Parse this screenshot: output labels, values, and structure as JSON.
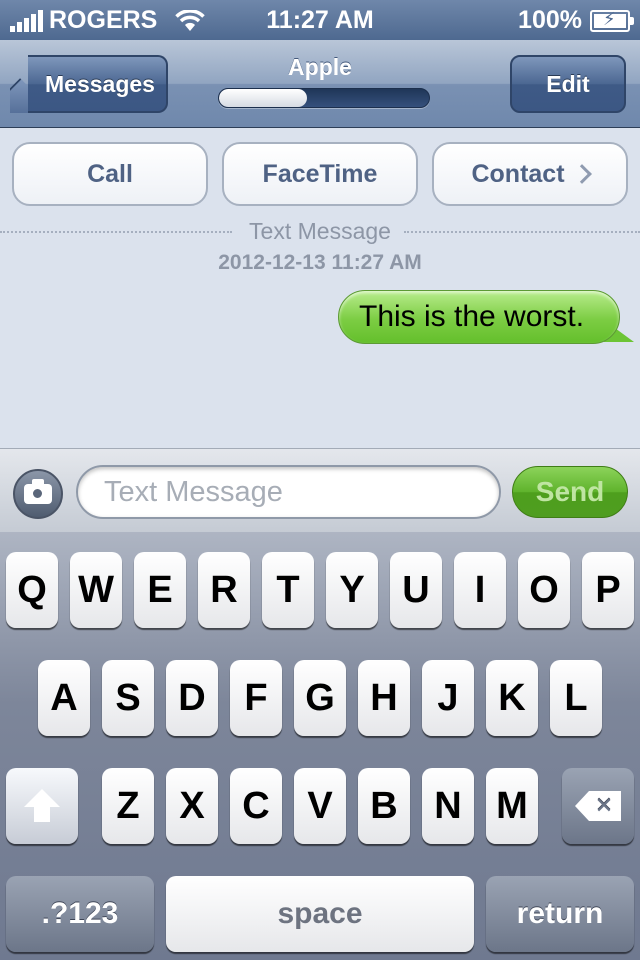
{
  "status_bar": {
    "carrier": "ROGERS",
    "time": "11:27 AM",
    "battery": "100%"
  },
  "nav": {
    "back_label": "Messages",
    "title": "Apple",
    "edit_label": "Edit",
    "progress_fraction": 0.42
  },
  "actions": {
    "call": "Call",
    "facetime": "FaceTime",
    "contact": "Contact"
  },
  "conversation": {
    "divider_label": "Text Message",
    "timestamp": "2012-12-13 11:27 AM",
    "messages": [
      {
        "text": "This is the worst.",
        "direction": "outgoing"
      }
    ]
  },
  "composer": {
    "placeholder": "Text Message",
    "send_label": "Send"
  },
  "keyboard": {
    "row1": [
      "Q",
      "W",
      "E",
      "R",
      "T",
      "Y",
      "U",
      "I",
      "O",
      "P"
    ],
    "row2": [
      "A",
      "S",
      "D",
      "F",
      "G",
      "H",
      "J",
      "K",
      "L"
    ],
    "row3": [
      "Z",
      "X",
      "C",
      "V",
      "B",
      "N",
      "M"
    ],
    "numbers_label": ".?123",
    "space_label": "space",
    "return_label": "return"
  },
  "colors": {
    "nav_blue": "#4b6792",
    "bubble_green": "#7ccd43",
    "send_green": "#5fb32c",
    "background": "#dbe2ed"
  },
  "icons": [
    "signal-bars-icon",
    "wifi-icon",
    "battery-icon",
    "chevron-right-icon",
    "camera-icon",
    "shift-arrow-icon",
    "delete-icon"
  ]
}
